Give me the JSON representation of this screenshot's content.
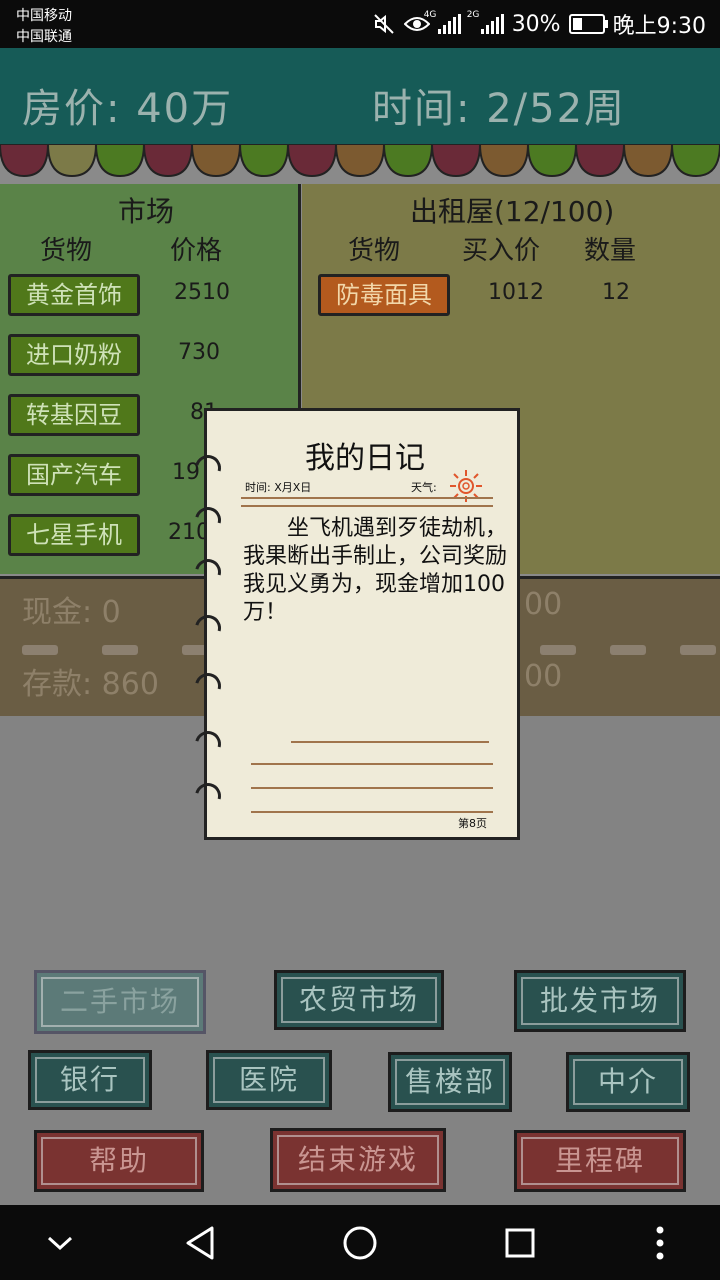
{
  "status_bar": {
    "carrier_1": "中国移动",
    "carrier_2": "中国联通",
    "icons": [
      "mute-icon",
      "eye-icon",
      "signal-4g-icon",
      "signal-2g-icon",
      "battery-icon"
    ],
    "net_1": "4G",
    "net_2": "2G",
    "battery": "30%",
    "time": "晚上9:30"
  },
  "header": {
    "house_price": "房价: 40万",
    "time": "时间: 2/52周"
  },
  "market": {
    "title": "市场",
    "col_goods": "货物",
    "col_price": "价格",
    "items": [
      {
        "name": "黄金首饰",
        "price": "2510"
      },
      {
        "name": "进口奶粉",
        "price": "730"
      },
      {
        "name": "转基因豆",
        "price": "81"
      },
      {
        "name": "国产汽车",
        "price": "19"
      },
      {
        "name": "七星手机",
        "price": "210"
      }
    ]
  },
  "rental": {
    "title": "出租屋(12/100)",
    "col_goods": "货物",
    "col_buy_price": "买入价",
    "col_qty": "数量",
    "items": [
      {
        "name": "防毒面具",
        "buy_price": "1012",
        "qty": "12"
      }
    ]
  },
  "finance": {
    "cash": "现金: 0",
    "deposit": "存款: 860",
    "cash_right": "00",
    "deposit_right": "00"
  },
  "buttons": {
    "second_hand": "二手市场",
    "farm_market": "农贸市场",
    "wholesale": "批发市场",
    "bank": "银行",
    "hospital": "医院",
    "sales_office": "售楼部",
    "agency": "中介",
    "help": "帮助",
    "end_game": "结束游戏",
    "milestone": "里程碑"
  },
  "diary": {
    "title": "我的日记",
    "date_label": "时间: X月X日",
    "weather_label": "天气:",
    "weather_icon": "sun-icon",
    "text": "坐飞机遇到歹徒劫机，我果断出手制止，公司奖励我见义勇为，现金增加100万！",
    "page": "第8页"
  },
  "nav": {
    "icons": [
      "chevron-down-icon",
      "back-icon",
      "home-icon",
      "recents-icon",
      "more-icon"
    ]
  },
  "colors": {
    "teal": "#165b57",
    "market_green": "#5a8348",
    "rental_olive": "#7c7a48",
    "money_brown": "#6a5d44",
    "paper": "#efebd9",
    "button_red": "#7a3331"
  }
}
